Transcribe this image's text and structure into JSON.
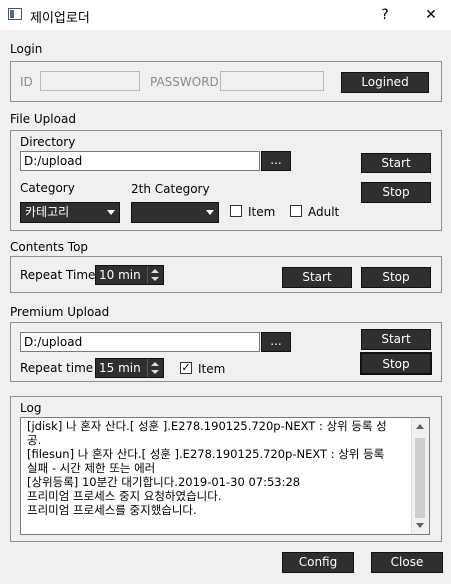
{
  "window": {
    "title": "제이업로더",
    "help_glyph": "?",
    "close_glyph": "✕"
  },
  "login": {
    "section": "Login",
    "id_label": "ID",
    "id_value": "",
    "password_label": "PASSWORD",
    "password_value": "",
    "button": "Logined"
  },
  "file_upload": {
    "section": "File Upload",
    "directory_label": "Directory",
    "directory_value": "D:/upload",
    "browse": "...",
    "start": "Start",
    "stop": "Stop",
    "category_label": "Category",
    "category_value": "카테고리",
    "category2_label": "2th Category",
    "category2_value": "",
    "item_label": "Item",
    "item_checked": false,
    "adult_label": "Adult",
    "adult_checked": false
  },
  "contents_top": {
    "section": "Contents Top",
    "repeat_label": "Repeat Time",
    "repeat_value": "10 min",
    "start": "Start",
    "stop": "Stop"
  },
  "premium_upload": {
    "section": "Premium Upload",
    "directory_value": "D:/upload",
    "browse": "...",
    "start": "Start",
    "stop": "Stop",
    "repeat_label": "Repeat time",
    "repeat_value": "15 min",
    "item_label": "Item",
    "item_checked": true,
    "check_glyph": "✓"
  },
  "log": {
    "section": "Log",
    "lines": [
      "[jdisk] 나 혼자 산다.[ 성훈 ].E278.190125.720p-NEXT : 상위 등록 성",
      "공.",
      "[filesun] 나 혼자 산다.[ 성훈 ].E278.190125.720p-NEXT : 상위 등록",
      "실패 - 시간 제한 또는 에러",
      "[상위등록] 10분간 대기합니다.2019-01-30 07:53:28",
      "프리미엄 프로세스 중지 요청하였습니다.",
      "프리미엄 프로세스를 중지했습니다."
    ]
  },
  "footer": {
    "config": "Config",
    "close": "Close"
  },
  "colors": {
    "dark_button": "#2f2f2f",
    "panel_bg": "#f0f0f0",
    "border": "#8f8f8f"
  }
}
